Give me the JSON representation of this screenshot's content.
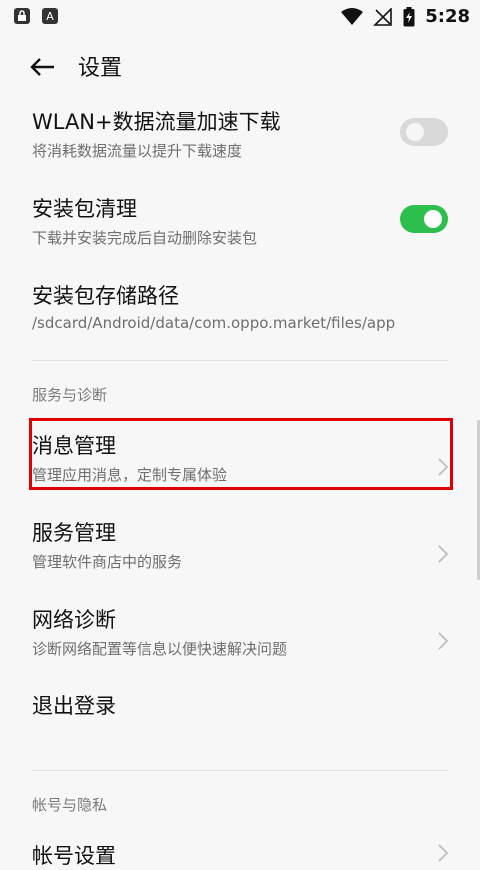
{
  "status_bar": {
    "time": "5:28",
    "icons": [
      "lock-icon",
      "a-icon",
      "wifi-icon",
      "no-signal-icon",
      "battery-charging-icon"
    ]
  },
  "header": {
    "title": "设置"
  },
  "rows": {
    "wlan": {
      "title": "WLAN+数据流量加速下载",
      "subtitle": "将消耗数据流量以提升下载速度",
      "toggle": "off"
    },
    "cleanup": {
      "title": "安装包清理",
      "subtitle": "下载并安装完成后自动删除安装包",
      "toggle": "on"
    },
    "path": {
      "title": "安装包存储路径",
      "subtitle": "/sdcard/Android/data/com.oppo.market/files/app"
    },
    "message": {
      "title": "消息管理",
      "subtitle": "管理应用消息，定制专属体验"
    },
    "service": {
      "title": "服务管理",
      "subtitle": "管理软件商店中的服务"
    },
    "network": {
      "title": "网络诊断",
      "subtitle": "诊断网络配置等信息以便快速解决问题"
    },
    "logout": {
      "title": "退出登录"
    },
    "account": {
      "title": "帐号设置"
    }
  },
  "sections": {
    "service_diag": "服务与诊断",
    "account_privacy": "帐号与隐私"
  },
  "colors": {
    "toggle_on": "#2cbf4e",
    "toggle_off": "#d9d9d9",
    "highlight": "#e00000"
  }
}
